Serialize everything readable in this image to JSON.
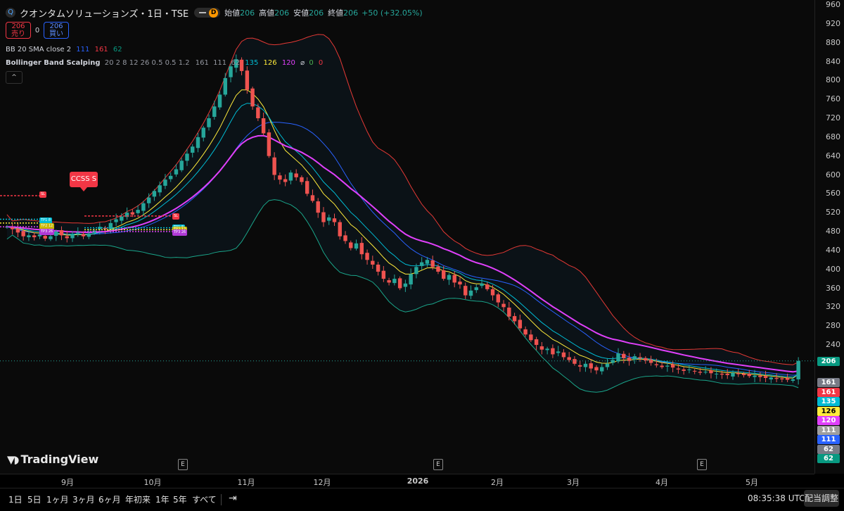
{
  "header": {
    "symbol": "クオンタムソリューションズ・1日・TSE",
    "exchange_logo": "Q",
    "market_status": "D",
    "open_label": "始値",
    "open": "206",
    "high_label": "高値",
    "high": "206",
    "low_label": "安値",
    "low": "206",
    "close_label": "終値",
    "close": "206",
    "change": "+50 (+32.05%)"
  },
  "trade": {
    "sell_price": "206",
    "sell_label": "売り",
    "spread": "0",
    "buy_price": "206",
    "buy_label": "買い"
  },
  "indicators": {
    "bb_name": "BB 20 SMA close 2",
    "bb_values": [
      "111",
      "161",
      "62"
    ],
    "bbs_name": "Bollinger Band Scalping",
    "bbs_params": "20 2 8 12 26 0.5 0.5 1.2",
    "bbs_values": [
      "161",
      "111",
      "62",
      "135",
      "126",
      "120"
    ],
    "bbs_icon": "⌀",
    "bbs_zero_a": "0",
    "bbs_zero_b": "0",
    "collapse_icon": "^"
  },
  "signal": {
    "label": "CCSS S"
  },
  "level_tags": {
    "stop": "SL",
    "tp1": "TP1 8",
    "tp2": "TP2 12",
    "tp3": "TP3 26"
  },
  "watermark": "TradingView",
  "earnings_marker": "E",
  "price_axis": {
    "ticks": [
      "960",
      "920",
      "880",
      "840",
      "800",
      "760",
      "720",
      "680",
      "640",
      "600",
      "560",
      "520",
      "480",
      "440",
      "400",
      "360",
      "320",
      "280",
      "240"
    ],
    "last_price_tag": "206",
    "value_tags": [
      "161",
      "161",
      "135",
      "126",
      "120",
      "111",
      "111",
      "62",
      "62"
    ],
    "tag_colors": [
      "#787b86",
      "#f23645",
      "#00bcd4",
      "#ffeb3b",
      "#e040fb",
      "#9e9e9e",
      "#2962ff",
      "#787b86",
      "#089981"
    ]
  },
  "time_axis": {
    "labels": [
      "9月",
      "10月",
      "11月",
      "12月",
      "2026",
      "2月",
      "3月",
      "4月",
      "5月"
    ]
  },
  "toolbar": {
    "ranges": [
      "1日",
      "5日",
      "1ヶ月",
      "3ヶ月",
      "6ヶ月",
      "年初来",
      "1年",
      "5年",
      "すべて"
    ],
    "compare_icon": "calendar-range-icon",
    "clock": "08:35:38 UTC",
    "adjust_label": "配当調整"
  },
  "chart_data": {
    "type": "candlestick",
    "title": "クオンタムソリューションズ・1日・TSE",
    "y_range": [
      230,
      965
    ],
    "last_price": 206,
    "x_labels": [
      "9月",
      "10月",
      "11月",
      "12月",
      "2026",
      "2月",
      "3月",
      "4月",
      "5月"
    ],
    "closes": [
      490,
      485,
      478,
      470,
      472,
      468,
      474,
      465,
      470,
      480,
      472,
      466,
      474,
      478,
      470,
      476,
      482,
      490,
      485,
      498,
      506,
      512,
      520,
      516,
      526,
      540,
      552,
      566,
      578,
      590,
      598,
      612,
      630,
      645,
      660,
      680,
      700,
      720,
      745,
      770,
      805,
      830,
      845,
      820,
      780,
      745,
      720,
      688,
      640,
      600,
      590,
      585,
      605,
      595,
      585,
      560,
      545,
      520,
      500,
      510,
      500,
      470,
      460,
      445,
      455,
      432,
      420,
      410,
      395,
      380,
      372,
      380,
      360,
      370,
      390,
      405,
      415,
      420,
      405,
      395,
      380,
      388,
      372,
      368,
      345,
      355,
      362,
      370,
      358,
      345,
      330,
      320,
      300,
      290,
      275,
      262,
      250,
      240,
      230,
      232,
      220,
      226,
      214,
      208,
      200,
      194,
      200,
      190,
      186,
      193,
      200,
      208,
      222,
      212,
      206,
      216,
      212,
      207,
      202,
      197,
      193,
      196,
      192,
      188,
      185,
      188,
      184,
      181,
      183,
      180,
      179,
      177,
      176,
      181,
      178,
      176,
      174,
      175,
      172,
      170,
      171,
      168,
      167,
      166,
      167,
      206
    ],
    "colors": {
      "up": "#26a69a",
      "down": "#ef5350"
    }
  }
}
